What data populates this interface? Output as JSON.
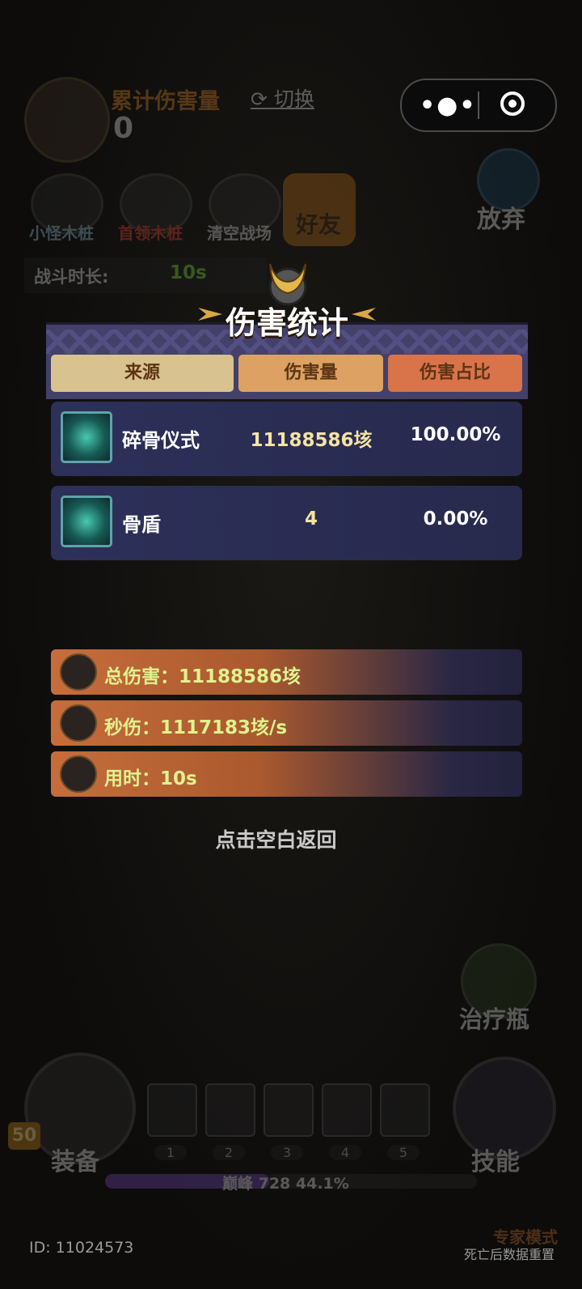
{
  "top_bar": {
    "cumulative_label": "累计伤害量",
    "cumulative_value": "0",
    "switch_label": "切换",
    "miniprogram_menu_icon": "more-dots-icon",
    "miniprogram_close_icon": "target-icon"
  },
  "modes": {
    "minion_stake": "小怪木桩",
    "boss_stake": "首领木桩",
    "clear_field": "清空战场",
    "friend": "好友",
    "give_up": "放弃"
  },
  "battle": {
    "duration_label": "战斗时长:",
    "duration_value": "10s"
  },
  "modal": {
    "title": "伤害统计",
    "columns": [
      "来源",
      "伤害量",
      "伤害占比"
    ],
    "rows": [
      {
        "icon": "vortex-skill-icon",
        "name": "碎骨仪式",
        "damage": "11188586垓",
        "share": "100.00%"
      },
      {
        "icon": "bone-shield-icon",
        "name": "骨盾",
        "damage": "4",
        "share": "0.00%"
      }
    ],
    "summary": {
      "total": "总伤害：11188586垓",
      "dps": "秒伤：1117183垓/s",
      "time": "用时：10s"
    },
    "back_hint": "点击空白返回"
  },
  "bottom": {
    "heal_label": "治疗瓶",
    "equip_label": "装备",
    "skill_label": "技能",
    "level": "50",
    "slots": [
      "1",
      "2",
      "3",
      "4",
      "5"
    ],
    "xp_text": "巅峰 728   44.1%",
    "xp_progress": 0.441,
    "player_id": "ID: 11024573",
    "expert_mode": "专家模式",
    "expert_note": "死亡后数据重置"
  },
  "colors": {
    "accent_gold": "#f4e3a3",
    "summary_text": "#dff28e",
    "row_bg": "#2d3059"
  }
}
